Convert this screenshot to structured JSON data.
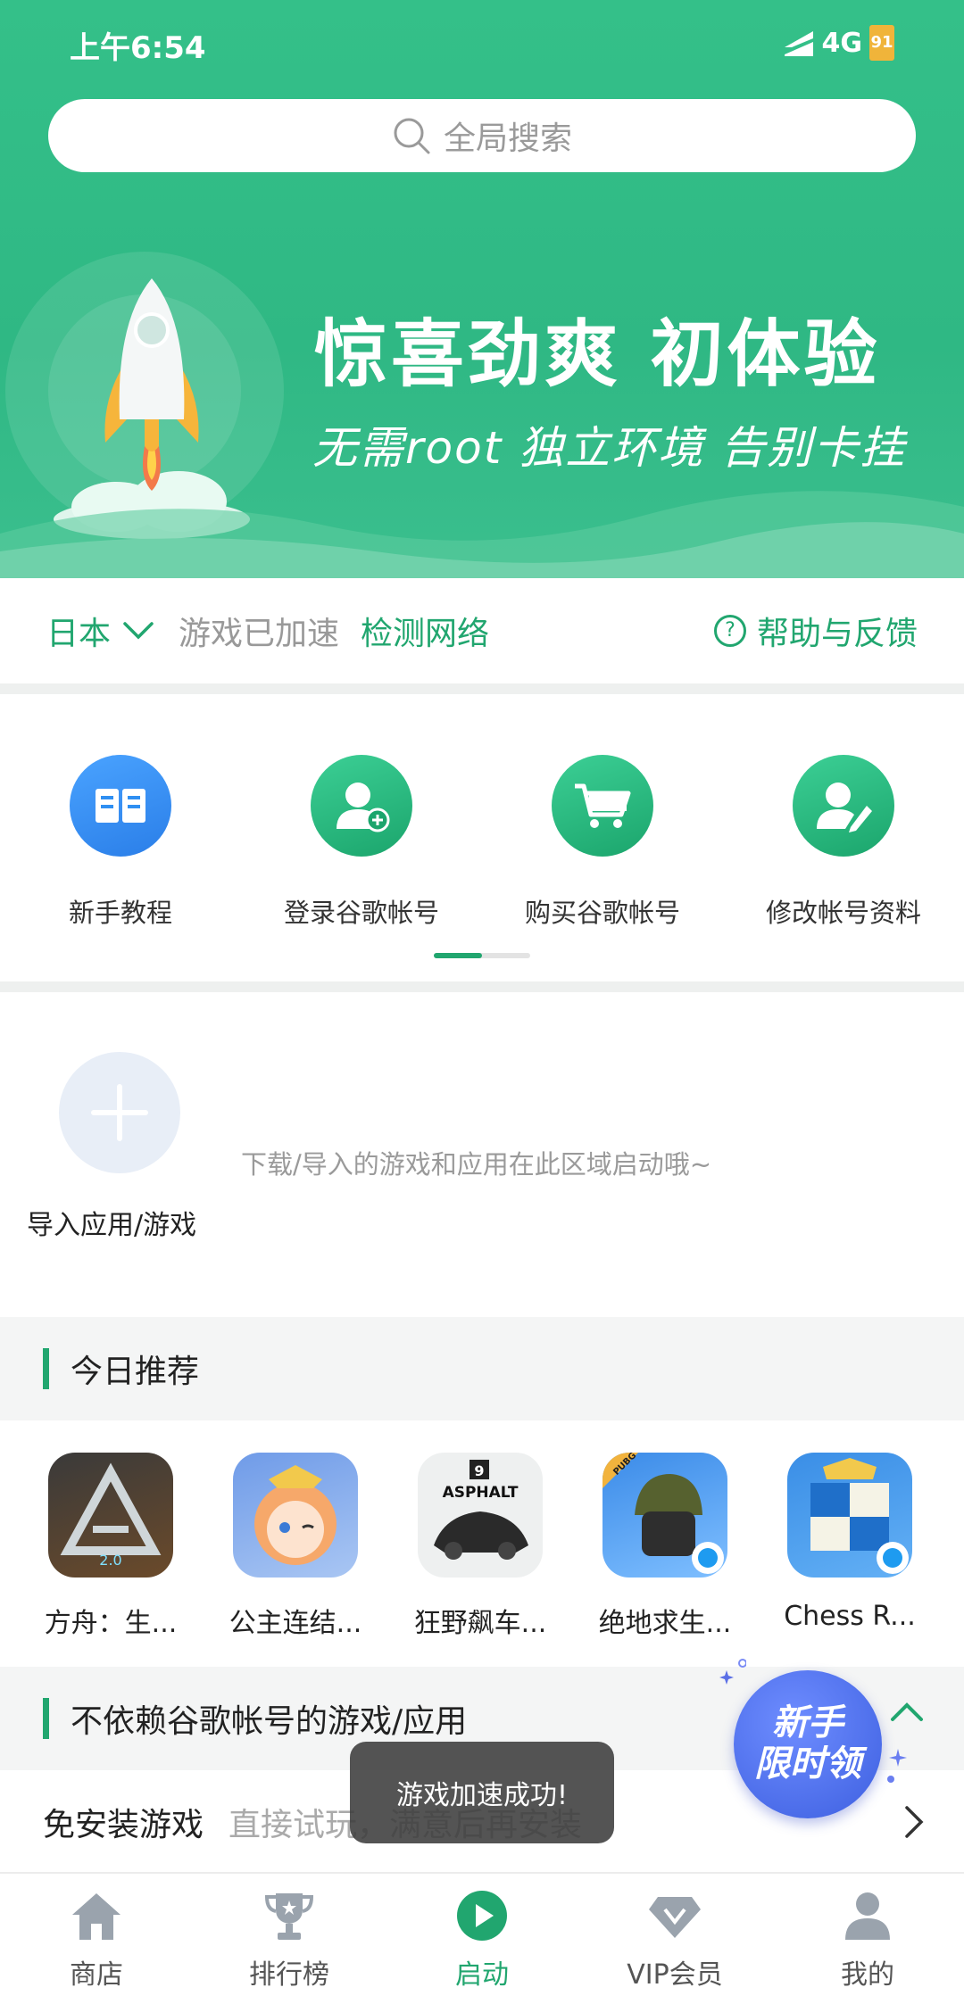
{
  "status_bar": {
    "time": "上午6:54",
    "network": "4G",
    "battery": "91"
  },
  "search": {
    "placeholder": "全局搜索"
  },
  "banner": {
    "title": "惊喜劲爽  初体验",
    "subtitle": "无需root  独立环境  告别卡挂"
  },
  "accel": {
    "region": "日本",
    "status": "游戏已加速",
    "detect": "检测网络",
    "help": "帮助与反馈"
  },
  "shortcuts": [
    {
      "label": "新手教程",
      "icon": "book-icon",
      "color": "#2f8ff2"
    },
    {
      "label": "登录谷歌帐号",
      "icon": "user-add-icon",
      "color": "#21b37a"
    },
    {
      "label": "购买谷歌帐号",
      "icon": "cart-icon",
      "color": "#21b37a"
    },
    {
      "label": "修改帐号资料",
      "icon": "user-edit-icon",
      "color": "#21b37a"
    }
  ],
  "import": {
    "label": "导入应用/游戏",
    "hint": "下载/导入的游戏和应用在此区域启动哦~"
  },
  "sections": {
    "today": "今日推荐",
    "no_google": "不依赖谷歌帐号的游戏/应用"
  },
  "games": [
    {
      "name": "方舟：生...",
      "badge": "2.0"
    },
    {
      "name": "公主连结..."
    },
    {
      "name": "狂野飙车...",
      "badge": "ASPHALT",
      "badge2": "9"
    },
    {
      "name": "绝地求生...",
      "badge": "PUBG"
    },
    {
      "name": "Chess R..."
    }
  ],
  "no_install": {
    "title": "免安装游戏",
    "desc": "直接试玩，满意后再安装"
  },
  "toast": "游戏加速成功!",
  "promo": {
    "line1": "新手",
    "line2": "限时领"
  },
  "tabs": [
    {
      "label": "商店",
      "icon": "home-icon"
    },
    {
      "label": "排行榜",
      "icon": "trophy-icon"
    },
    {
      "label": "启动",
      "icon": "play-icon",
      "active": true
    },
    {
      "label": "VIP会员",
      "icon": "diamond-icon"
    },
    {
      "label": "我的",
      "icon": "person-icon"
    }
  ],
  "colors": {
    "accent": "#21a66f",
    "banner": "#34c089"
  }
}
